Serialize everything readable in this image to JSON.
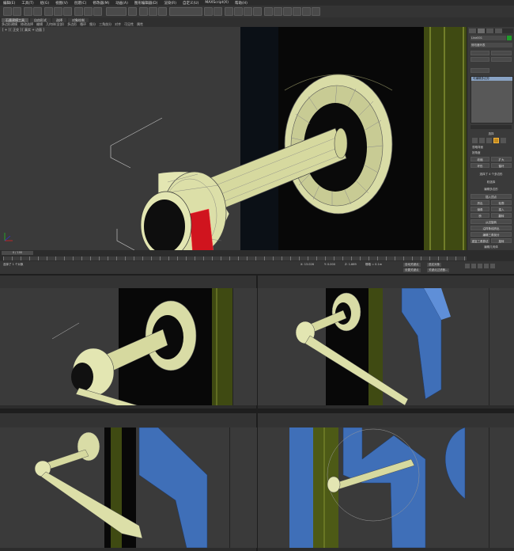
{
  "menu": [
    "编辑(E)",
    "工具(T)",
    "组(G)",
    "视图(V)",
    "创建(C)",
    "修改器(M)",
    "动画(A)",
    "图形编辑器(D)",
    "渲染(R)",
    "自定义(U)",
    "MAXScript(X)",
    "帮助(H)"
  ],
  "ribbon": {
    "tabs": [
      "石墨建模工具",
      "自由形式",
      "选择",
      "对象绘制"
    ],
    "items": [
      "多边形建模",
      "修改选择",
      "编辑",
      "几何体(全部)",
      "多边形",
      "循环",
      "细分",
      "三角剖分",
      "对齐",
      "可见性",
      "属性"
    ]
  },
  "main_viewport": {
    "label": "[ + ] [ 正交 ] [ 真实 + 边面 ]"
  },
  "command_panel": {
    "object_name": "Line001",
    "modifier_list": "修改器列表",
    "stack_item": "可编辑多边形",
    "selection_rollout": "选择",
    "ignore_backfacing": "忽略背面",
    "by_angle": "按角度",
    "shrink": "收缩",
    "grow": "扩大",
    "ring": "环形",
    "loop": "循环",
    "selected_count": "选择了 4 个多边形",
    "soft_selection": "软选择",
    "edit_polygons": "编辑多边形",
    "insert_vertex": "插入顶点",
    "extrude": "挤出",
    "outline": "轮廓",
    "bevel": "倒角",
    "inset": "插入",
    "bridge": "桥",
    "flip": "翻转",
    "hinge": "从边旋转",
    "extrude_spline": "沿样条线挤出",
    "edit_triangulation": "编辑三角剖分",
    "retriangulate": "重复三角算法",
    "turn": "旋转",
    "edit_geometry": "编辑几何体"
  },
  "timeline": {
    "frame": "0 / 100"
  },
  "status": {
    "selection": "选择了 1 个对象",
    "x": "X: 13.026",
    "y": "Y: 0.000",
    "z": "Z: 1.669",
    "grid": "栅格 = 0.1m",
    "autokey": "自动关键点",
    "selected": "选定对象",
    "set_key": "设置关键点",
    "key_filters": "关键点过滤器..."
  },
  "colors": {
    "knob": "#e3e6b2",
    "door": "#3f6fb8",
    "frame": "#4d5a16",
    "selected_poly": "#d0141e"
  }
}
